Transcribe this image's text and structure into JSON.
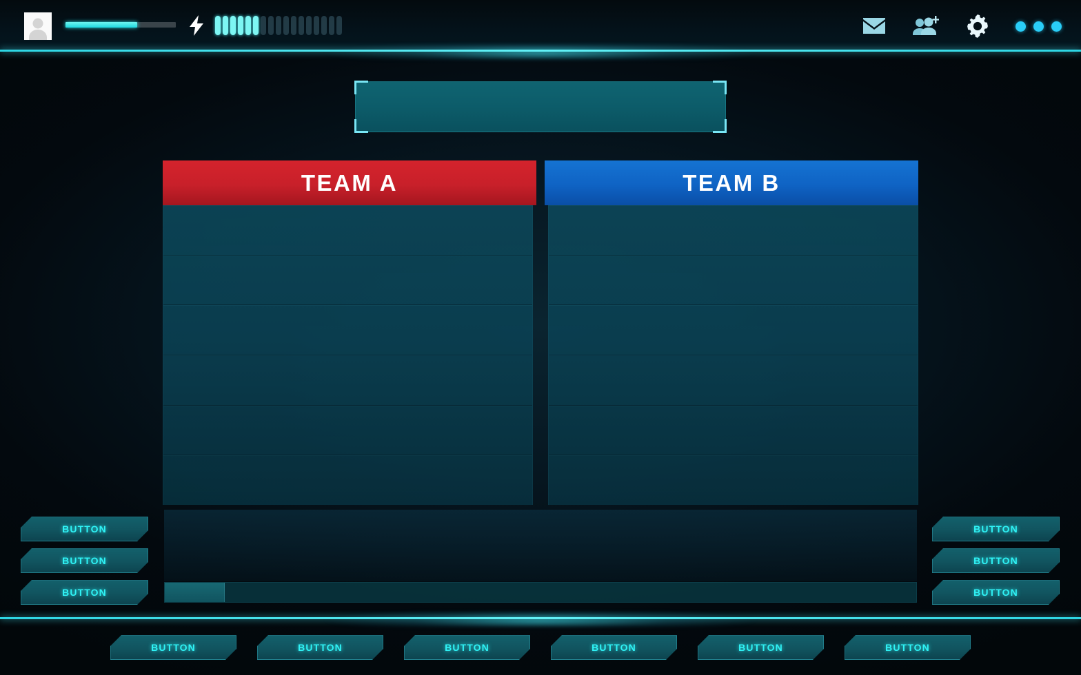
{
  "topbar": {
    "avatar_icon": "user-avatar-icon",
    "xp": {
      "percent": 65
    },
    "energy": {
      "bolt_icon": "lightning-bolt-icon",
      "total_segments": 17,
      "filled_segments": 6
    },
    "icons": [
      {
        "name": "mail-icon",
        "label": "Mail"
      },
      {
        "name": "add-friends-icon",
        "label": "Add Friends"
      },
      {
        "name": "settings-gear-icon",
        "label": "Settings"
      },
      {
        "name": "more-options-icon",
        "label": "More"
      }
    ]
  },
  "banner": {
    "title": ""
  },
  "rosters": {
    "teams": [
      {
        "name": "TEAM A",
        "color": "#c8202a",
        "slots": [
          "",
          "",
          "",
          "",
          "",
          ""
        ]
      },
      {
        "name": "TEAM B",
        "color": "#0f63c4",
        "slots": [
          "",
          "",
          "",
          "",
          "",
          ""
        ]
      }
    ]
  },
  "side_left": {
    "buttons": [
      {
        "label": "BUTTON"
      },
      {
        "label": "BUTTON"
      },
      {
        "label": "BUTTON"
      }
    ]
  },
  "side_right": {
    "buttons": [
      {
        "label": "BUTTON"
      },
      {
        "label": "BUTTON"
      },
      {
        "label": "BUTTON"
      }
    ]
  },
  "status_bar": {
    "value": "",
    "percent": 8
  },
  "bottom_bar": {
    "buttons": [
      {
        "label": "BUTTON"
      },
      {
        "label": "BUTTON"
      },
      {
        "label": "BUTTON"
      },
      {
        "label": "BUTTON"
      },
      {
        "label": "BUTTON"
      },
      {
        "label": "BUTTON"
      }
    ]
  },
  "colors": {
    "accent_cyan": "#2ff3f6",
    "glow_line": "#63f1f6",
    "team_a_red": "#c8202a",
    "team_b_blue": "#0f63c4",
    "panel_teal": "#0c4658",
    "background": "#03080b"
  }
}
